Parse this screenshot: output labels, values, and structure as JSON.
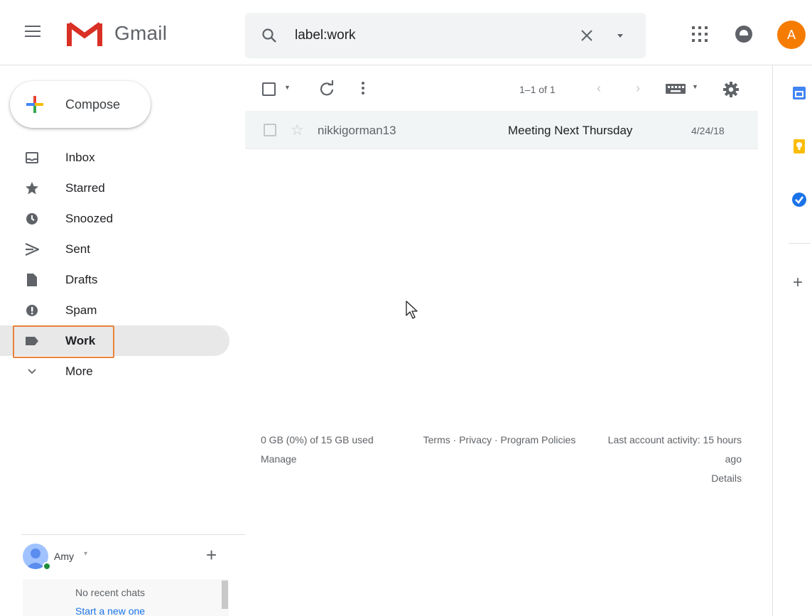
{
  "header": {
    "app_name": "Gmail",
    "search_value": "label:work",
    "account_initial": "A",
    "colors": {
      "avatar": "#f57c00",
      "gmail_red": "#d93025"
    }
  },
  "sidebar": {
    "compose_label": "Compose",
    "items": [
      {
        "label": "Inbox",
        "icon": "inbox-icon"
      },
      {
        "label": "Starred",
        "icon": "star-icon"
      },
      {
        "label": "Snoozed",
        "icon": "clock-icon"
      },
      {
        "label": "Sent",
        "icon": "send-icon"
      },
      {
        "label": "Drafts",
        "icon": "draft-icon"
      },
      {
        "label": "Spam",
        "icon": "spam-icon"
      },
      {
        "label": "Work",
        "icon": "label-icon",
        "active": true
      },
      {
        "label": "More",
        "icon": "chevron-down-icon"
      }
    ],
    "chat": {
      "user_name": "Amy",
      "empty_text": "No recent chats",
      "start_link": "Start a new one"
    }
  },
  "toolbar": {
    "count_text": "1–1 of 1"
  },
  "emails": [
    {
      "sender": "nikkigorman13",
      "subject": "Meeting Next Thursday",
      "date": "4/24/18"
    }
  ],
  "footer": {
    "storage": "0 GB (0%) of 15 GB used",
    "manage": "Manage",
    "terms": "Terms · Privacy · Program Policies",
    "activity": "Last account activity: 15 hours ago",
    "details": "Details"
  },
  "right_panel": {
    "apps": [
      "calendar-icon",
      "keep-icon",
      "tasks-icon"
    ]
  }
}
